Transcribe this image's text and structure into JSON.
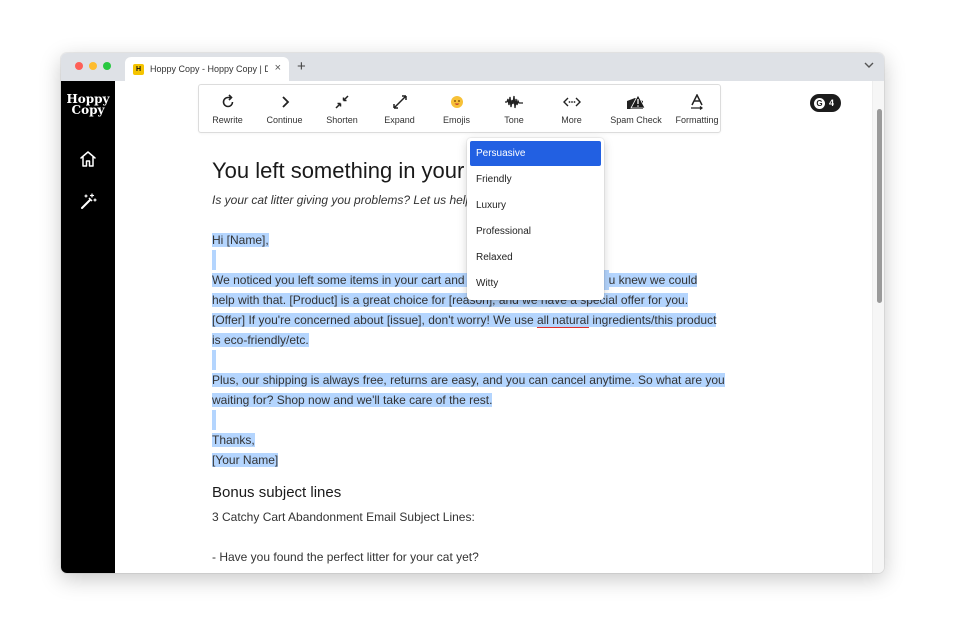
{
  "browser": {
    "tab_title": "Hoppy Copy - Hoppy Copy | De",
    "tab_favicon": "H",
    "close_glyph": "×",
    "new_tab_glyph": "+"
  },
  "sidebar": {
    "logo_line1": "Hoppy",
    "logo_line2": "Copy",
    "items": [
      {
        "icon": "home-icon"
      },
      {
        "icon": "magic-wand-icon"
      }
    ]
  },
  "toolbar": {
    "items": [
      {
        "label": "Rewrite",
        "icon": "rewrite-icon"
      },
      {
        "label": "Continue",
        "icon": "chevron-right-icon"
      },
      {
        "label": "Shorten",
        "icon": "shrink-icon"
      },
      {
        "label": "Expand",
        "icon": "expand-icon"
      },
      {
        "label": "Emojis",
        "icon": "emoji-icon"
      },
      {
        "label": "Tone",
        "icon": "waveform-icon"
      },
      {
        "label": "More",
        "icon": "more-icon"
      },
      {
        "label": "Spam Check",
        "icon": "spam-check-icon"
      },
      {
        "label": "Formatting",
        "icon": "formatting-icon"
      }
    ]
  },
  "grammarly_badge": {
    "letter": "G",
    "count": "4"
  },
  "tone_menu": {
    "items": [
      "Persuasive",
      "Friendly",
      "Luxury",
      "Professional",
      "Relaxed",
      "Witty"
    ],
    "selected": "Persuasive"
  },
  "document": {
    "title": "You left something in your c",
    "subtitle": "Is your cat litter giving you problems? Let us help",
    "greeting": "Hi [Name],",
    "para1_line1_a": "We noticed you left some items in your cart and w",
    "para1_line1_b": "u knew we could",
    "para1_line2_a": "help with that. [Product] is a great choice for [reason], and we have a special offer for you.",
    "para1_line3_a": "[Offer] If you're concerned about [issue], don't worry! We use ",
    "para1_line3_u": "all natural",
    "para1_line3_b": " ingredients/this product",
    "para1_line4": "is eco-friendly/etc.",
    "para2_line1": "Plus, our shipping is always free, returns are easy, and you can cancel anytime. So what are you",
    "para2_line2": "waiting for? Shop now and we'll take care of the rest.",
    "closing": "Thanks,",
    "signature": "[Your Name]",
    "bonus_heading": "Bonus subject lines",
    "bonus_intro": "3 Catchy Cart Abandonment Email Subject Lines:",
    "bonus_item1": "- Have you found the perfect litter for your cat yet?"
  },
  "colors": {
    "selection": "#b4d5fe",
    "menu_active": "#2260e2",
    "sidebar": "#000000",
    "spellcheck": "#e0312b"
  }
}
